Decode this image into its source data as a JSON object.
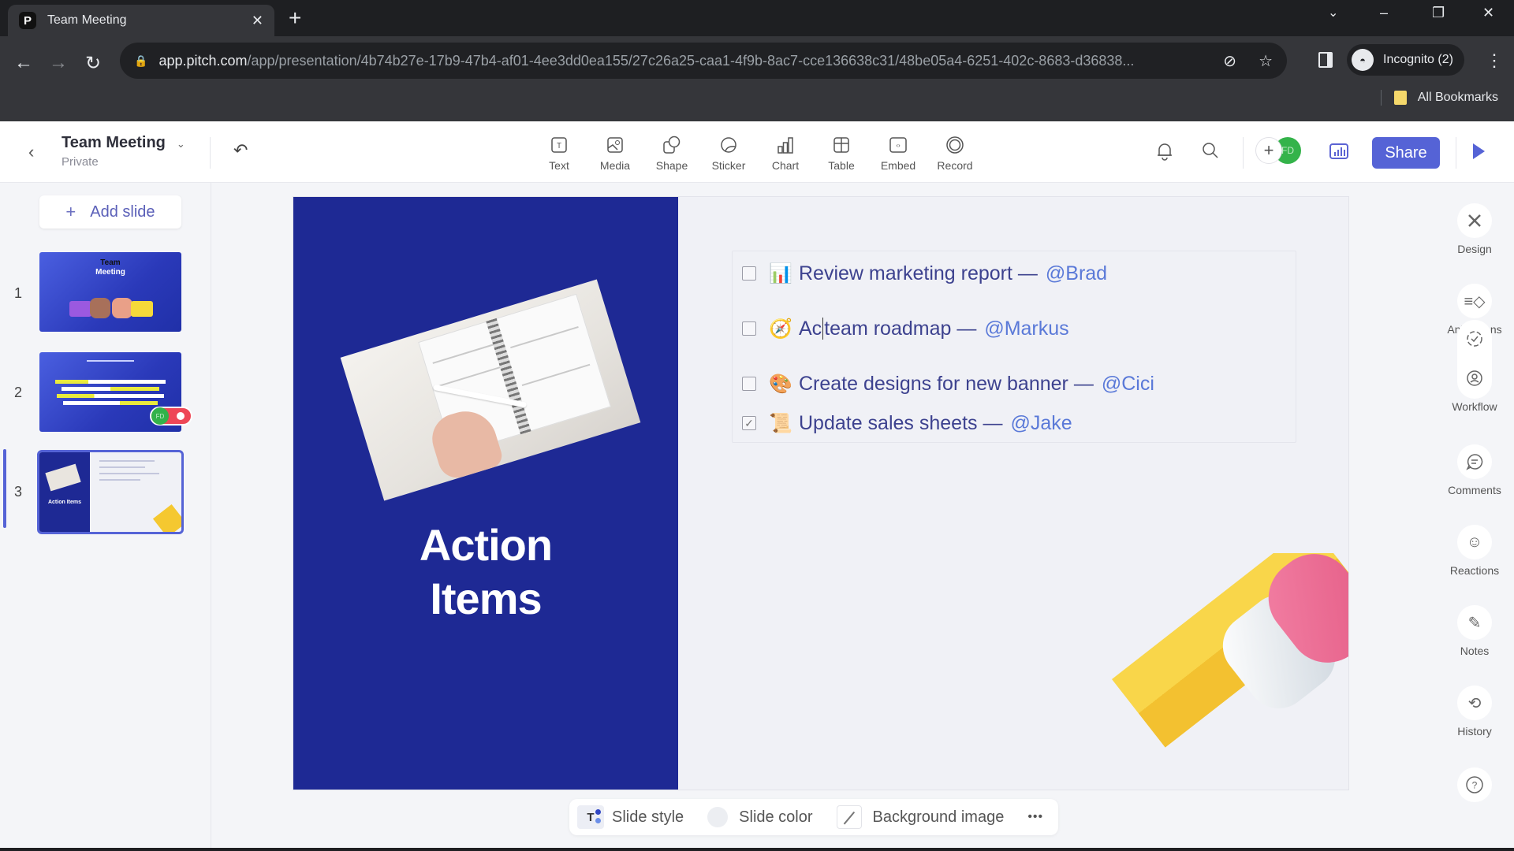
{
  "browser": {
    "tab_title": "Team Meeting",
    "tab_favicon": "P",
    "url_host": "app.pitch.com",
    "url_path": "/app/presentation/4b74b27e-17b9-47b4-af01-4ee3dd0ea155/27c26a25-caa1-4f9b-8ac7-cce136638c31/48be05a4-6251-402c-8683-d36838...",
    "profile_label": "Incognito (2)",
    "bookmarks_label": "All Bookmarks"
  },
  "app": {
    "doc_title": "Team Meeting",
    "doc_visibility": "Private",
    "insert_tools": [
      {
        "label": "Text",
        "icon": "text-icon"
      },
      {
        "label": "Media",
        "icon": "media-icon"
      },
      {
        "label": "Shape",
        "icon": "shape-icon"
      },
      {
        "label": "Sticker",
        "icon": "sticker-icon"
      },
      {
        "label": "Chart",
        "icon": "chart-icon"
      },
      {
        "label": "Table",
        "icon": "table-icon"
      },
      {
        "label": "Embed",
        "icon": "embed-icon"
      },
      {
        "label": "Record",
        "icon": "record-icon"
      }
    ],
    "collaborator_initials": "FD",
    "share_label": "Share",
    "accent_color": "#5563d6"
  },
  "sidebar": {
    "add_slide_label": "Add slide",
    "slides": [
      {
        "number": "1",
        "thumb_title_line1": "Team",
        "thumb_title_line2": "Meeting"
      },
      {
        "number": "2",
        "presence_initials": "FD"
      },
      {
        "number": "3",
        "thumb_title": "Action Items",
        "active": true
      }
    ]
  },
  "slide": {
    "title_line1": "Action",
    "title_line2": "Items",
    "background_left": "#1e2994",
    "items": [
      {
        "emoji": "📊",
        "text": "Review marketing report —",
        "mention": "@Brad",
        "checked": false
      },
      {
        "emoji": "🧭",
        "text_before_caret": "Ac",
        "text": " team roadmap —",
        "mention": "@Markus",
        "checked": false
      },
      {
        "emoji": "🎨",
        "text": "Create designs for new banner —",
        "mention": "@Cici",
        "checked": false
      },
      {
        "emoji": "📜",
        "text": "Update sales sheets —",
        "mention": "@Jake",
        "checked": true
      }
    ]
  },
  "bottombar": {
    "slide_style": "Slide style",
    "slide_color": "Slide color",
    "background_image": "Background image",
    "more": "•••"
  },
  "rail": {
    "design": "Design",
    "animations": "Animations",
    "workflow": "Workflow",
    "comments": "Comments",
    "reactions": "Reactions",
    "notes": "Notes",
    "history": "History",
    "help": "?"
  }
}
